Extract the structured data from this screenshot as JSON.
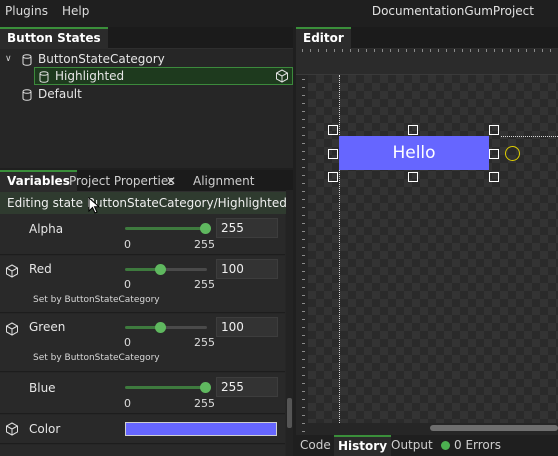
{
  "menubar": {
    "items": [
      "Plugins",
      "Help"
    ],
    "project_title": "DocumentationGumProject"
  },
  "states_panel": {
    "tab_label": "Button States",
    "category_label": "ButtonStateCategory",
    "selected_state_label": "Highlighted",
    "default_state_label": "Default"
  },
  "vars_panel": {
    "tabs": [
      "Variables",
      "Project Properties",
      "Alignment"
    ],
    "tab_close_glyph": "✕",
    "editing_text": "Editing state ButtonStateCategory/Highlighted",
    "rows": [
      {
        "name": "Alpha",
        "value": "255",
        "min": "0",
        "max": "255",
        "level": 1.0,
        "set_by": ""
      },
      {
        "name": "Red",
        "value": "100",
        "min": "0",
        "max": "255",
        "level": 0.39,
        "set_by": "Set by ButtonStateCategory"
      },
      {
        "name": "Green",
        "value": "100",
        "min": "0",
        "max": "255",
        "level": 0.39,
        "set_by": "Set by ButtonStateCategory"
      },
      {
        "name": "Blue",
        "value": "255",
        "min": "0",
        "max": "255",
        "level": 1.0,
        "set_by": ""
      }
    ],
    "color_row": {
      "name": "Color",
      "swatch_color": "#6666ff"
    }
  },
  "editor": {
    "tab_label": "Editor",
    "button_text": "Hello",
    "bottom_tabs": [
      "Code",
      "History",
      "Output"
    ],
    "errors_text": "0 Errors"
  },
  "colors": {
    "accent_green": "#3a8f3a",
    "button_fill": "#6666ff",
    "origin_marker": "#e0d000"
  },
  "icons": [
    "chevron-down-icon",
    "cylinder-icon",
    "cube-icon",
    "mouse-cursor-icon",
    "close-icon"
  ]
}
